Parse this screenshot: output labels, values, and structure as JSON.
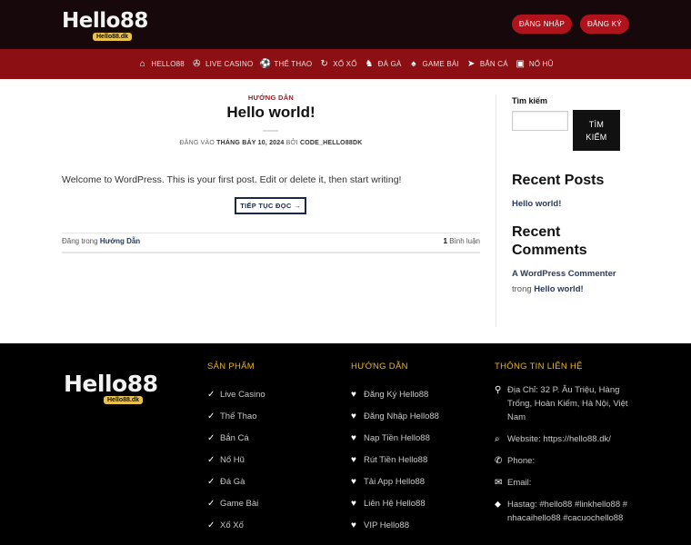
{
  "header": {
    "logo_text": "Hello88",
    "logo_sub": "Hello88.dk",
    "login_label": "ĐĂNG NHẬP",
    "register_label": "ĐĂNG KÝ"
  },
  "nav": {
    "items": [
      {
        "label": "HELLO88",
        "icon": "home-icon",
        "glyph": "⌂"
      },
      {
        "label": "LIVE CASINO",
        "icon": "chip-icon",
        "glyph": "✇"
      },
      {
        "label": "THỂ THAO",
        "icon": "ball-icon",
        "glyph": "⚽"
      },
      {
        "label": "XỔ XỐ",
        "icon": "lottery-icon",
        "glyph": "↻"
      },
      {
        "label": "ĐÁ GÀ",
        "icon": "rooster-icon",
        "glyph": "♞"
      },
      {
        "label": "GAME BÀI",
        "icon": "cards-icon",
        "glyph": "♠"
      },
      {
        "label": "BẮN CÁ",
        "icon": "fish-icon",
        "glyph": "➤"
      },
      {
        "label": "NỔ HŨ",
        "icon": "slot-icon",
        "glyph": "▣"
      }
    ]
  },
  "post": {
    "category": "HƯỚNG DẪN",
    "title": "Hello world!",
    "meta_prefix": "ĐĂNG VÀO",
    "meta_date": "THÁNG BẢY 10, 2024",
    "meta_by": "BỞI",
    "meta_author": "CODE_HELLO88DK",
    "content": "Welcome to WordPress. This is your first post. Edit or delete it, then start writing!",
    "readmore_label": "TIẾP TỤC ĐỌC →",
    "posted_in": "Đăng trong",
    "posted_category": "Hướng Dẫn",
    "comments_count": "1",
    "comments_label": "Bình luận"
  },
  "sidebar": {
    "search_label": "Tìm kiếm",
    "search_placeholder": "",
    "search_button_line1": "TÌM",
    "search_button_line2": "KIẾM",
    "recent_posts_heading": "Recent Posts",
    "recent_post": "Hello world!",
    "recent_comments_heading_1": "Recent",
    "recent_comments_heading_2": "Comments",
    "comment_author": "A WordPress Commenter",
    "comment_in": "trong",
    "comment_post": "Hello world!"
  },
  "footer": {
    "logo_text": "Hello88",
    "logo_sub": "Hello88.dk",
    "products": {
      "heading": "SẢN PHẨM",
      "items": [
        "Live Casino",
        "Thể Thao",
        "Bắn Cá",
        "Nổ Hũ",
        "Đá Gà",
        "Game Bài",
        "Xổ Xố"
      ]
    },
    "guides": {
      "heading": "HƯỚNG DẪN",
      "items": [
        "Đăng Ký Hello88",
        "Đăng Nhập Hello88",
        "Nạp Tiền Hello88",
        "Rút Tiền Hello88",
        "Tải App Hello88",
        "Liên Hệ Hello88",
        "VIP Hello88"
      ]
    },
    "contact": {
      "heading": "THÔNG TIN LIÊN HỆ",
      "address": "Địa Chỉ: 32 P. Âu Triệu, Hàng Trống, Hoàn Kiếm, Hà Nội, Việt Nam",
      "website": "Website: https://hello88.dk/",
      "phone": "Phone:",
      "email": "Email:",
      "hashtag": "Hastag: #hello88 #linkhello88 # nhacaihello88 #cacuochello88"
    }
  },
  "colors": {
    "topbar": "#17090b",
    "nav": "#8b0f13",
    "button": "#b0131b",
    "footer_heading": "#e8b428"
  }
}
